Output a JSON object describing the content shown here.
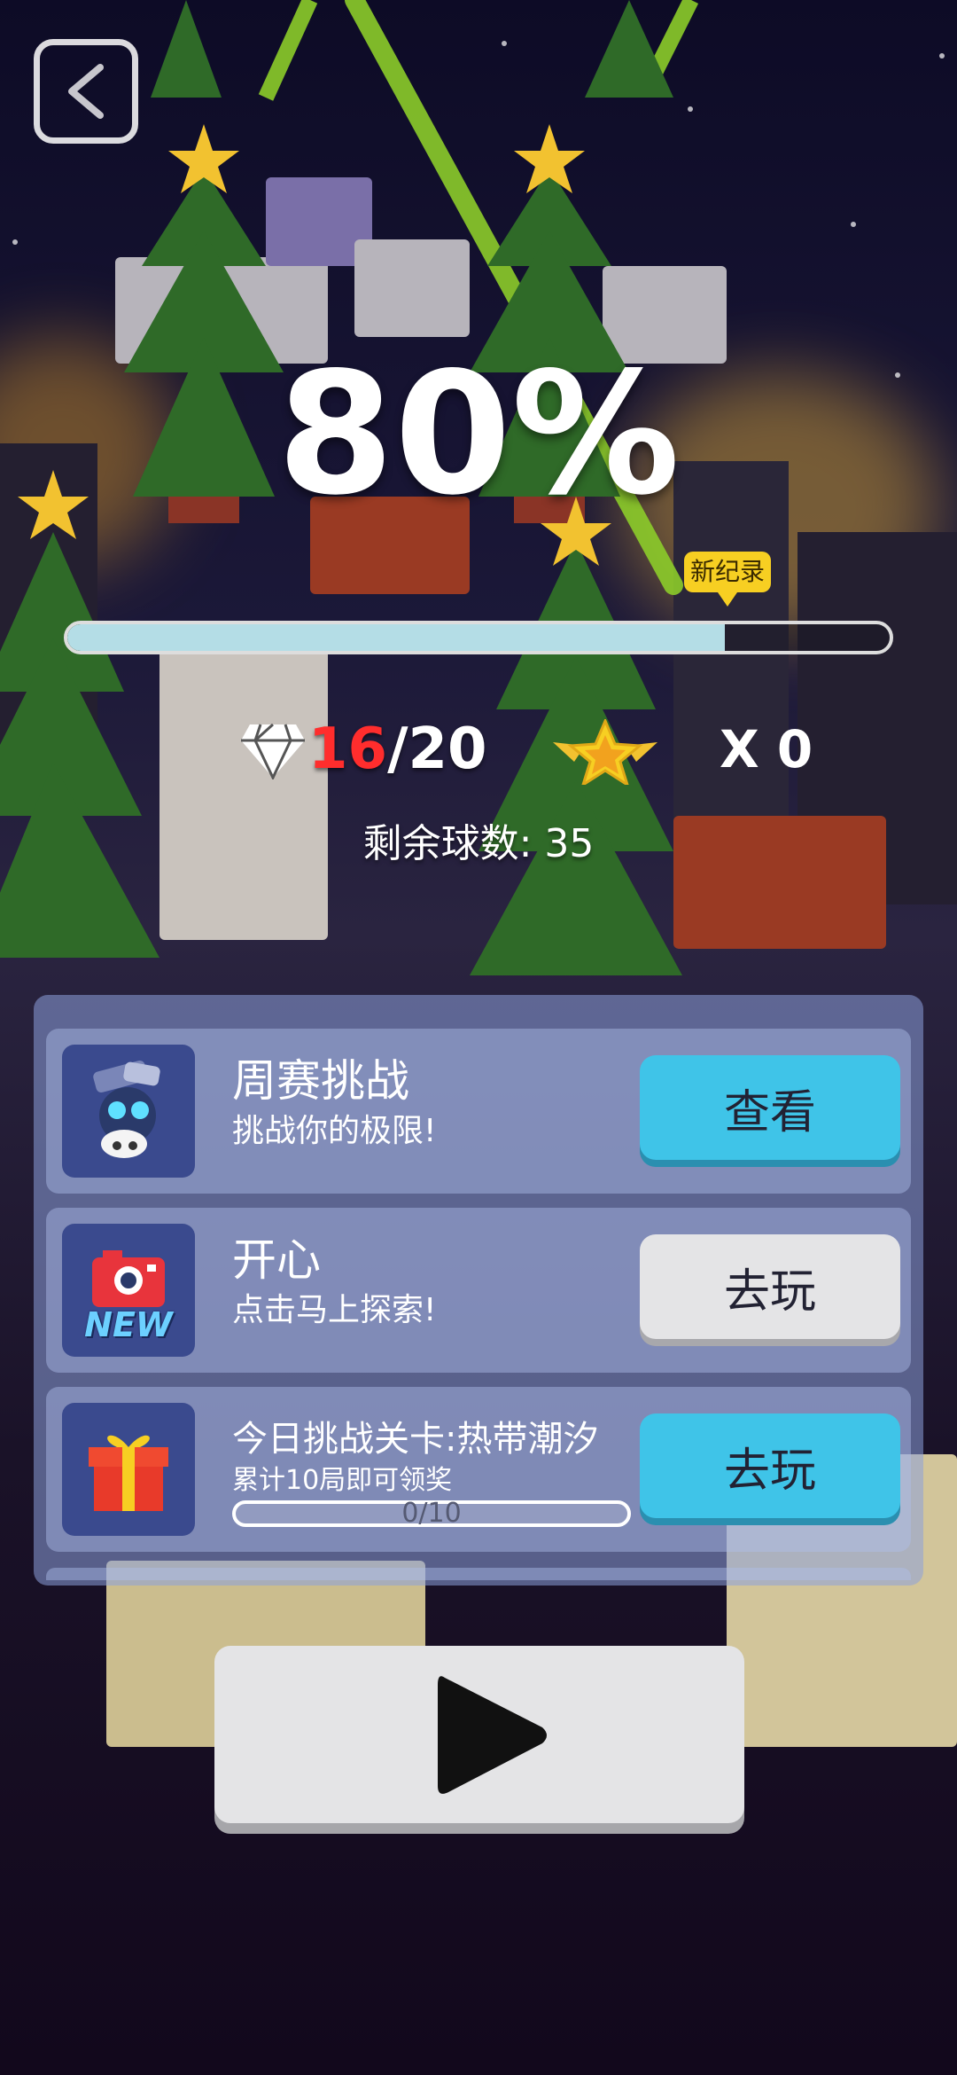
{
  "game": {
    "progress_percent_text": "80%",
    "progress_fraction": 0.8,
    "new_record_label": "新纪录",
    "gems": {
      "collected": "16",
      "total": "/20"
    },
    "stars_text": "X 0",
    "remaining_balls": "剩余球数: 35"
  },
  "tasks": [
    {
      "title": "周赛挑战",
      "subtitle": "挑战你的极限!",
      "button": "查看",
      "icon": "robot-icon"
    },
    {
      "title": "开心",
      "subtitle": "点击马上探索!",
      "button": "去玩",
      "icon": "new-camera-icon",
      "icon_text": "NEW"
    },
    {
      "title": "今日挑战关卡:热带潮汐",
      "subtitle": "累计10局即可领奖",
      "button": "去玩",
      "icon": "gift-icon",
      "progress_text": "0/10",
      "progress_fraction": 0
    }
  ],
  "colors": {
    "accent_blue": "#3fc4e8",
    "gem_red": "#ff2d2d",
    "star_gold": "#f7cf22"
  }
}
